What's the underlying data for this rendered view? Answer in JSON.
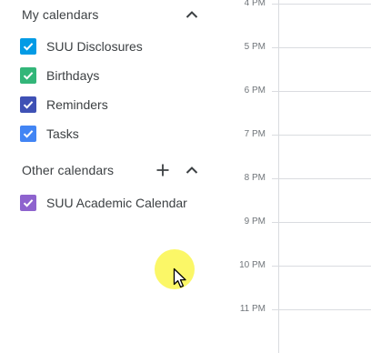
{
  "my_calendars": {
    "title": "My calendars",
    "items": [
      {
        "label": "SUU Disclosures",
        "color": "#039be5",
        "checked": true
      },
      {
        "label": "Birthdays",
        "color": "#33b679",
        "checked": true
      },
      {
        "label": "Reminders",
        "color": "#3f51b5",
        "checked": true
      },
      {
        "label": "Tasks",
        "color": "#4285f4",
        "checked": true
      }
    ]
  },
  "other_calendars": {
    "title": "Other calendars",
    "items": [
      {
        "label": "SUU Academic Calendar",
        "color": "#8e63ce",
        "checked": true
      }
    ]
  },
  "time_grid": {
    "times": [
      "4 PM",
      "5 PM",
      "6 PM",
      "7 PM",
      "8 PM",
      "9 PM",
      "10 PM",
      "11 PM"
    ],
    "line_color": "#dadce0"
  },
  "icons": {
    "collapse": "chevron-up-icon",
    "add": "plus-icon",
    "check": "check-icon",
    "cursor": "mouse-pointer-icon"
  },
  "colors": {
    "text": "#3c4043",
    "time_text": "#70757a",
    "cursor_highlight": "#faf546"
  }
}
